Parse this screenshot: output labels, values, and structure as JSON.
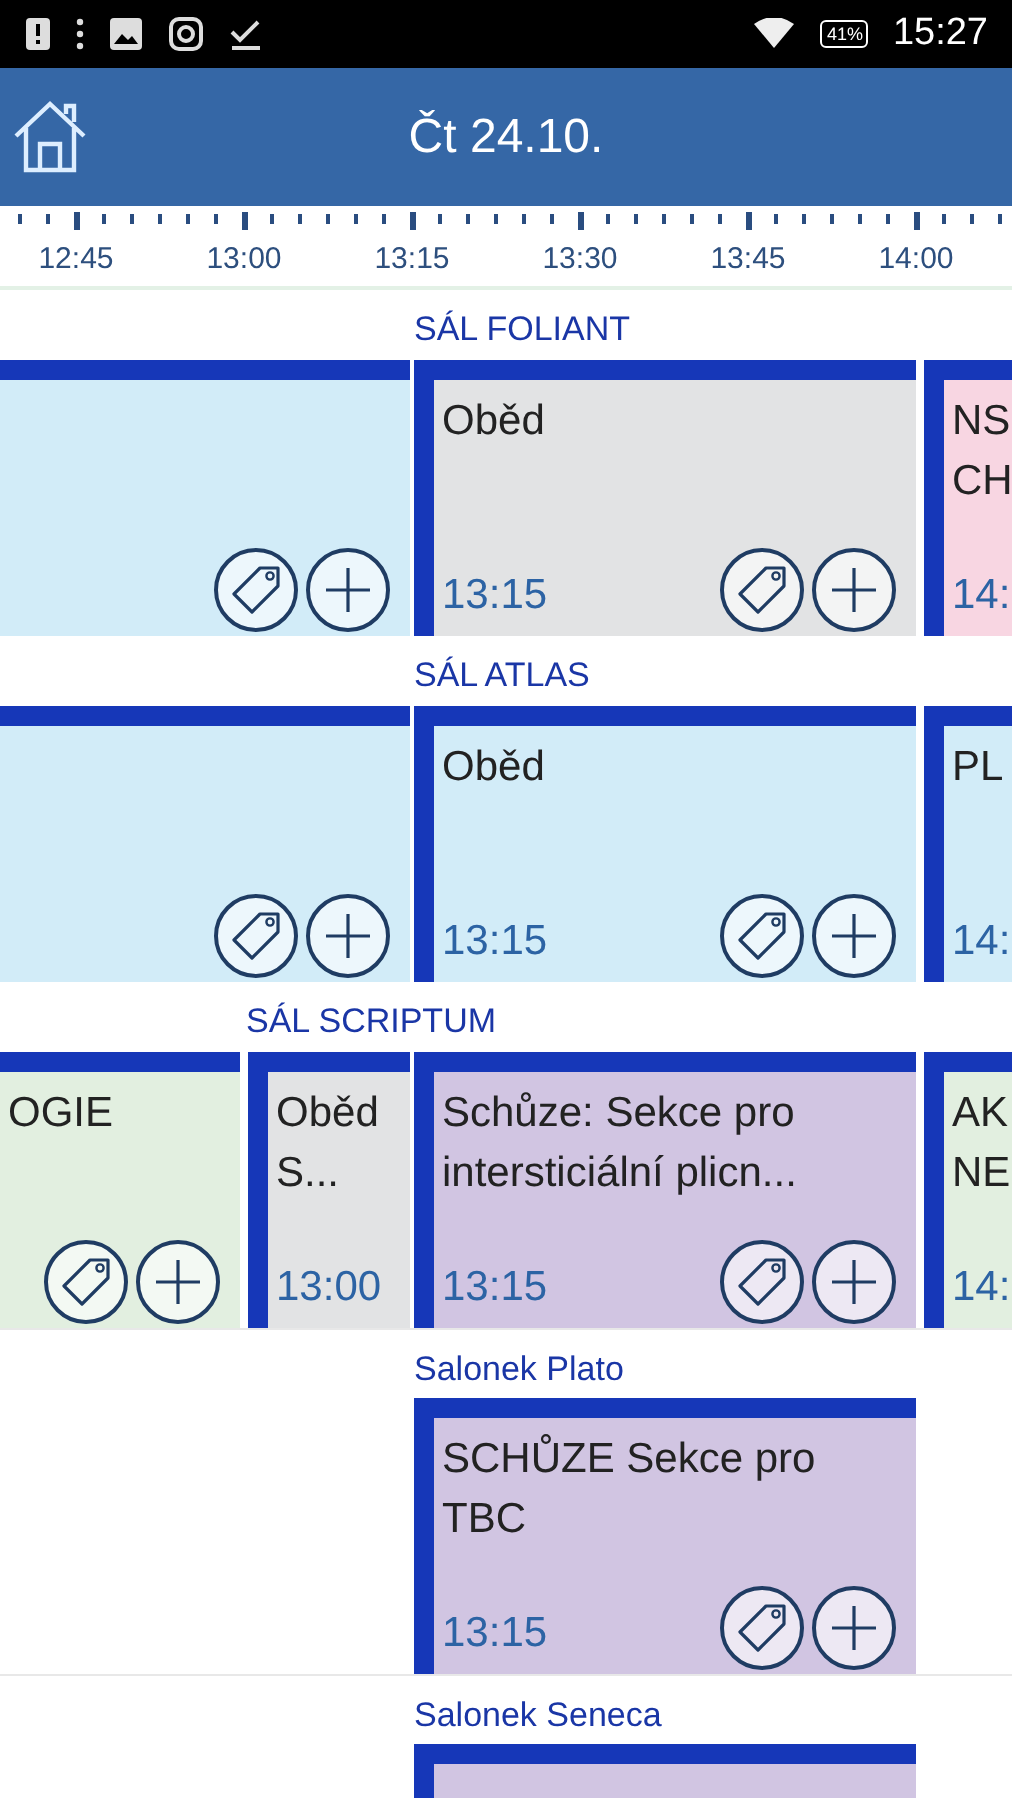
{
  "status_bar": {
    "battery": "41%",
    "time": "15:27"
  },
  "header": {
    "title": "Čt 24.10."
  },
  "time_ruler": [
    "12:45",
    "13:00",
    "13:15",
    "13:30",
    "13:45",
    "14:00"
  ],
  "rooms": [
    {
      "name": "SÁL FOLIANT",
      "events": [
        {
          "color": "#d2ecf8",
          "has_actions": true
        },
        {
          "title": "Oběd",
          "time": "13:15",
          "color": "#e2e3e4",
          "has_actions": true
        },
        {
          "title": "NS CH",
          "time": "14:",
          "color": "#f8d6e2",
          "has_actions": false
        }
      ]
    },
    {
      "name": "SÁL ATLAS",
      "events": [
        {
          "color": "#d2ecf8",
          "has_actions": true
        },
        {
          "title": "Oběd",
          "time": "13:15",
          "color": "#d2ecf8",
          "has_actions": true
        },
        {
          "title": "PL",
          "time": "14:",
          "color": "#d2ecf8",
          "has_actions": false
        }
      ]
    },
    {
      "name": "SÁL SCRIPTUM",
      "events": [
        {
          "title": "OGIE",
          "color": "#e2efe0",
          "has_actions": true
        },
        {
          "title": "Oběd S...",
          "time": "13:00",
          "color": "#e2e3e4",
          "has_actions": false
        },
        {
          "title": "Schůze: Sekce pro intersticiální plicn...",
          "time": "13:15",
          "color": "#d1c5e2",
          "has_actions": true
        },
        {
          "title": "AK NE",
          "time": "14:",
          "color": "#e2efe0",
          "has_actions": false
        }
      ]
    },
    {
      "name": "Salonek Plato",
      "events": [
        {
          "title": "SCHŮZE Sekce pro TBC",
          "time": "13:15",
          "color": "#d1c5e2",
          "has_actions": true
        }
      ]
    },
    {
      "name": "Salonek Seneca",
      "events": [
        {
          "color": "#d1c5e2",
          "has_actions": false
        }
      ]
    }
  ]
}
